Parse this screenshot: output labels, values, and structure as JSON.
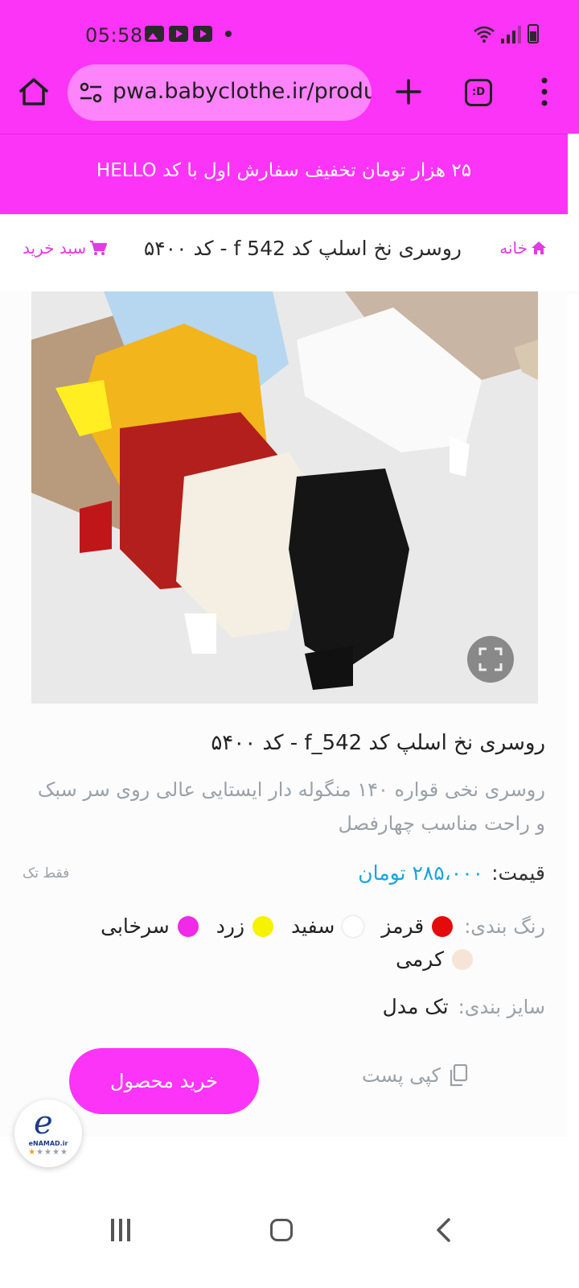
{
  "status_bar": {
    "time": "05:58"
  },
  "browser": {
    "url": "pwa.babyclothe.ir/produ",
    "tab_label": ":D"
  },
  "promo": {
    "text": "۲۵ هزار تومان تخفیف سفارش اول با کد HELLO"
  },
  "header": {
    "home_label": "خانه",
    "title": "روسری نخ اسلپ کد f 542 - کد ۵۴۰۰",
    "cart_label": "سبد خرید"
  },
  "product": {
    "title": "روسری نخ اسلپ کد f_542 - کد ۵۴۰۰",
    "description": "روسری نخی قواره ۱۴۰ منگوله دار ایستایی عالی روی سر سبک و راحت مناسب چهارفصل",
    "price_label": "قیمت:",
    "price_value": "۲۸۵،۰۰۰ تومان",
    "only_single": "فقط تک",
    "colors_label": "رنگ بندی:",
    "colors": [
      {
        "name": "قرمز",
        "hex": "#e30b0b"
      },
      {
        "name": "سفید",
        "hex": "#ffffff"
      },
      {
        "name": "زرد",
        "hex": "#f6f200"
      },
      {
        "name": "سرخابی",
        "hex": "#f02ae6"
      },
      {
        "name": "کرمی",
        "hex": "#f6e5d6"
      }
    ],
    "size_label": "سایز بندی:",
    "size_value": "تک مدل",
    "buy_label": "خرید محصول",
    "copy_label": "کپی پست"
  },
  "enamad": {
    "label": "eNAMAD.ir"
  },
  "theme": {
    "brand": "#fc34f7",
    "price_color": "#1aa3e0"
  }
}
